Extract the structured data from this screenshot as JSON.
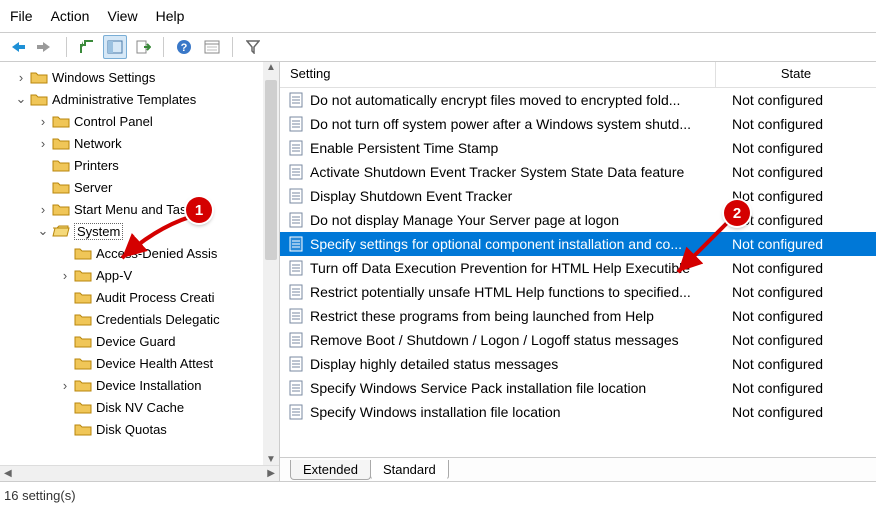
{
  "menu": {
    "file": "File",
    "action": "Action",
    "view": "View",
    "help": "Help"
  },
  "columns": {
    "setting": "Setting",
    "state": "State"
  },
  "tabs": {
    "extended": "Extended",
    "standard": "Standard"
  },
  "status": "16 setting(s)",
  "callouts": {
    "one": "1",
    "two": "2"
  },
  "tree": {
    "windows_settings": "Windows Settings",
    "admin_templates": "Administrative Templates",
    "control_panel": "Control Panel",
    "network": "Network",
    "printers": "Printers",
    "server": "Server",
    "start_menu": "Start Menu and Taskbar",
    "system": "System",
    "access_denied": "Access-Denied Assis",
    "appv": "App-V",
    "audit": "Audit Process Creati",
    "credentials": "Credentials Delegatic",
    "device_guard": "Device Guard",
    "device_health": "Device Health Attest",
    "device_install": "Device Installation",
    "disk_nv": "Disk NV Cache",
    "disk_quotas": "Disk Quotas"
  },
  "settings": [
    {
      "name": "Do not automatically encrypt files moved to encrypted fold...",
      "state": "Not configured"
    },
    {
      "name": "Do not turn off system power after a Windows system shutd...",
      "state": "Not configured"
    },
    {
      "name": "Enable Persistent Time Stamp",
      "state": "Not configured"
    },
    {
      "name": "Activate Shutdown Event Tracker System State Data feature",
      "state": "Not configured"
    },
    {
      "name": "Display Shutdown Event Tracker",
      "state": "Not configured"
    },
    {
      "name": "Do not display Manage Your Server page at logon",
      "state": "Not configured"
    },
    {
      "name": "Specify settings for optional component installation and co...",
      "state": "Not configured"
    },
    {
      "name": "Turn off Data Execution Prevention for HTML Help Executible",
      "state": "Not configured"
    },
    {
      "name": "Restrict potentially unsafe HTML Help functions to specified...",
      "state": "Not configured"
    },
    {
      "name": "Restrict these programs from being launched from Help",
      "state": "Not configured"
    },
    {
      "name": "Remove Boot / Shutdown / Logon / Logoff status messages",
      "state": "Not configured"
    },
    {
      "name": "Display highly detailed status messages",
      "state": "Not configured"
    },
    {
      "name": "Specify Windows Service Pack installation file location",
      "state": "Not configured"
    },
    {
      "name": "Specify Windows installation file location",
      "state": "Not configured"
    }
  ]
}
